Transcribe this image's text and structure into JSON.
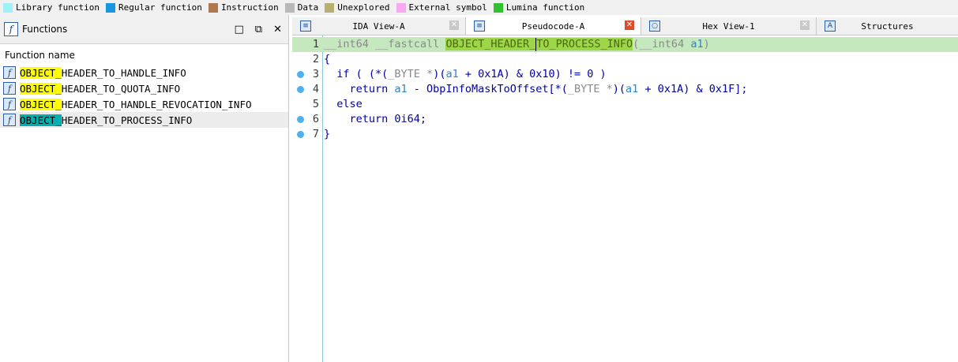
{
  "legend": [
    {
      "label": "Library function",
      "color": "#a0f0f8"
    },
    {
      "label": "Regular function",
      "color": "#1896e0"
    },
    {
      "label": "Instruction",
      "color": "#b07850"
    },
    {
      "label": "Data",
      "color": "#b8b8b8"
    },
    {
      "label": "Unexplored",
      "color": "#b8b070"
    },
    {
      "label": "External symbol",
      "color": "#f8a8f0"
    },
    {
      "label": "Lumina function",
      "color": "#30c030"
    }
  ],
  "functions_panel": {
    "title": "Functions",
    "column_header": "Function name",
    "items": [
      {
        "prefix": "OBJECT_",
        "rest": "HEADER_TO_HANDLE_INFO"
      },
      {
        "prefix": "OBJECT_",
        "rest": "HEADER_TO_QUOTA_INFO"
      },
      {
        "prefix": "OBJECT_",
        "rest": "HEADER_TO_HANDLE_REVOCATION_INFO"
      },
      {
        "prefix": "OBJECT_",
        "rest": "HEADER_TO_PROCESS_INFO"
      }
    ]
  },
  "tabs": [
    {
      "label": "IDA View-A"
    },
    {
      "label": "Pseudocode-A"
    },
    {
      "label": "Hex View-1"
    },
    {
      "label": "Structures"
    }
  ],
  "code": {
    "line_numbers": [
      "1",
      "2",
      "3",
      "4",
      "5",
      "6",
      "7"
    ],
    "l1": {
      "ret": "__int64 __fastcall ",
      "fname_a": "OBJECT_HEADER_",
      "fname_b": "TO_PROCESS_INFO",
      "open": "(",
      "ptype": "__int64 ",
      "arg": "a1",
      "close": ")"
    },
    "l2": "{",
    "l3": {
      "a": "  if ( (*(",
      "t": "_BYTE *",
      "b": ")(",
      "v": "a1",
      "c": " + 0x1A) & 0x10) != 0 )"
    },
    "l4": {
      "a": "    return ",
      "v1": "a1",
      "b": " - ObpInfoMaskToOffset[*(",
      "t": "_BYTE *",
      "c": ")(",
      "v2": "a1",
      "d": " + 0x1A) & 0x1F];"
    },
    "l5": "  else",
    "l6": "    return 0i64;",
    "l7": "}"
  }
}
